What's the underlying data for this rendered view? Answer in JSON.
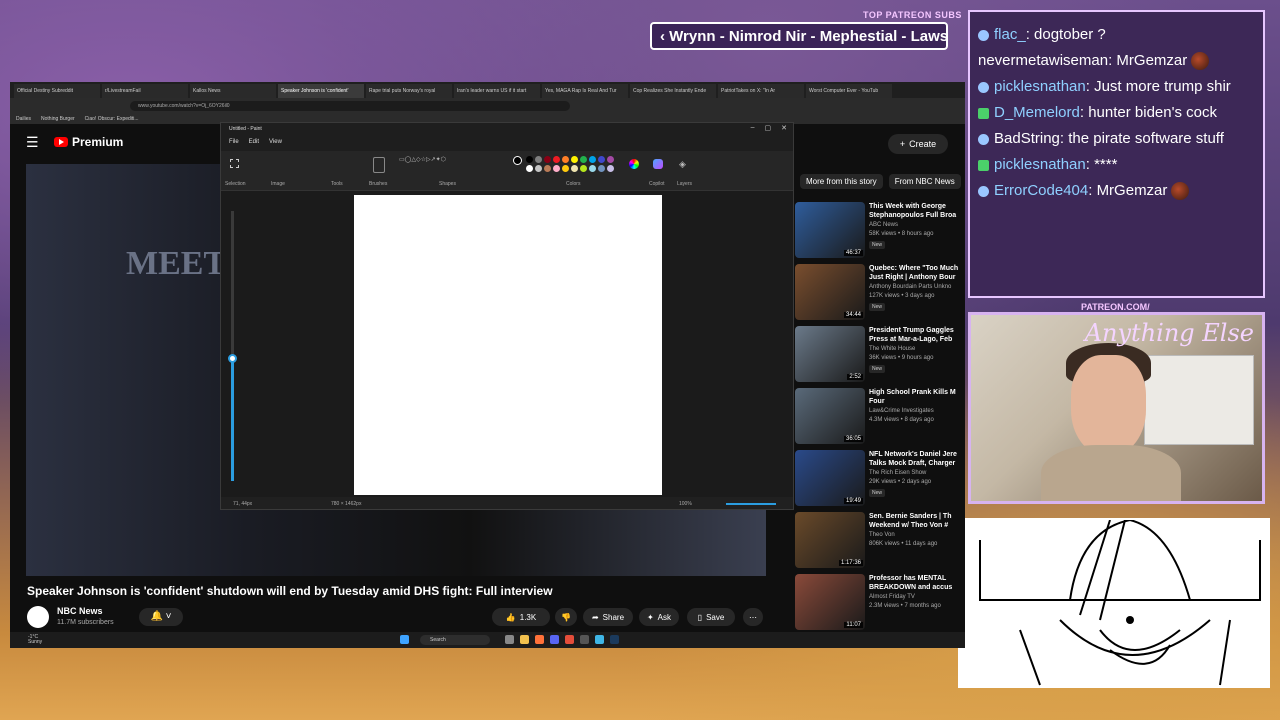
{
  "overlay": {
    "top_subs_label": "TOP PATREON SUBS",
    "ticker_text": "‹ Wrynn - Nimrod Nir - Mephestial - Lawsc",
    "patreon_label": "PATREON.COM/",
    "cam_logo": "Anything Else"
  },
  "chat": [
    {
      "badge": "b",
      "user": "flac_",
      "color": "blue",
      "message": "dogtober ?"
    },
    {
      "badge": "",
      "user": "nevermetawiseman",
      "color": "white",
      "message": "MrGemzar",
      "emote": true
    },
    {
      "badge": "b",
      "user": "picklesnathan",
      "color": "blue",
      "message": "Just more trump shir"
    },
    {
      "badge": "k",
      "user": "D_Memelord",
      "color": "blue",
      "message": "hunter biden's cock"
    },
    {
      "badge": "b",
      "user": "BadString",
      "color": "white",
      "message": "the pirate software stuff"
    },
    {
      "badge": "k",
      "user": "picklesnathan",
      "color": "blue",
      "message": "****"
    },
    {
      "badge": "b",
      "user": "ErrorCode404",
      "color": "blue",
      "message": "MrGemzar",
      "emote": true
    }
  ],
  "browser": {
    "tabs": [
      "Official Destiny Subreddit",
      "r/LivestreamFail",
      "Kallos News",
      "Speaker Johnson is 'confident'",
      "Rape trial puts Norway's royal",
      "Iran's leader warns US if it start",
      "Yes, MAGA Rap Is Real And Tur",
      "Cop Realizes She Instantly Ende",
      "PatriotTakes on X: \"In Ar",
      "Worst Computer Ever - YouTub"
    ],
    "active_tab_index": 3,
    "address": "www.youtube.com/watch?v=Oj_6OY26il0",
    "bookmarks": [
      "Dailies",
      "Nothing Burger",
      "Ciao! Obscur: Expediti..."
    ]
  },
  "youtube": {
    "logo_text": "Premium",
    "create_label": "Create",
    "video_title": "Speaker Johnson is 'confident' shutdown will end by Tuesday amid DHS fight: Full interview",
    "channel_name": "NBC News",
    "channel_subs": "11.7M subscribers",
    "likes": "1.3K",
    "share_label": "Share",
    "ask_label": "Ask",
    "save_label": "Save",
    "player_bg_text": "MEET THE PRESS",
    "rec_tabs": [
      "More from this story",
      "From NBC News"
    ],
    "recommendations": [
      {
        "title": "This Week with George Stephanopoulos Full Broa",
        "channel": "ABC News",
        "meta": "58K views • 8 hours ago",
        "duration": "46:37",
        "new": "New",
        "thumb": "#2f5d9c"
      },
      {
        "title": "Quebec: Where \"Too Much Just Right | Anthony Bour",
        "channel": "Anthony Bourdain Parts Unkno",
        "meta": "127K views • 3 days ago",
        "duration": "34:44",
        "new": "New",
        "thumb": "#7a4e2e"
      },
      {
        "title": "President Trump Gaggles Press at Mar-a-Lago, Feb",
        "channel": "The White House",
        "meta": "36K views • 9 hours ago",
        "duration": "2:52",
        "new": "New",
        "thumb": "#6b7a8a"
      },
      {
        "title": "High School Prank Kills M Four",
        "channel": "Law&Crime Investigates",
        "meta": "4.3M views • 8 days ago",
        "duration": "36:05",
        "new": "",
        "thumb": "#5a6a7a"
      },
      {
        "title": "NFL Network's Daniel Jere Talks Mock Draft, Charger",
        "channel": "The Rich Eisen Show",
        "meta": "29K views • 2 days ago",
        "duration": "19:49",
        "new": "New",
        "thumb": "#2a4a8a"
      },
      {
        "title": "Sen. Bernie Sanders | Th Weekend w/ Theo Von #",
        "channel": "Theo Von",
        "meta": "806K views • 11 days ago",
        "duration": "1:17:36",
        "new": "",
        "thumb": "#6a4a2a"
      },
      {
        "title": "Professor has MENTAL BREAKDOWN and accus",
        "channel": "Almost Friday TV",
        "meta": "2.3M views • 7 months ago",
        "duration": "11:07",
        "new": "",
        "thumb": "#8a4a3a"
      }
    ]
  },
  "paint": {
    "title": "Untitled - Paint",
    "menu": [
      "File",
      "Edit",
      "View"
    ],
    "groups": [
      "Selection",
      "Image",
      "Tools",
      "Brushes",
      "Shapes",
      "Colors",
      "Copilot",
      "Layers"
    ],
    "palette": [
      "#000000",
      "#7f7f7f",
      "#880015",
      "#ed1c24",
      "#ff7f27",
      "#fff200",
      "#22b14c",
      "#00a2e8",
      "#3f48cc",
      "#a349a4",
      "#ffffff",
      "#c3c3c3",
      "#b97a57",
      "#ffaec9",
      "#ffc90e",
      "#efe4b0",
      "#b5e61d",
      "#99d9ea",
      "#7092be",
      "#c8bfe7"
    ],
    "status_pos": "71, 44px",
    "status_size": "780 × 1462px",
    "zoom": "100%"
  },
  "taskbar": {
    "weather_temp": "-1°C",
    "weather_desc": "Sunny",
    "search_label": "Search"
  }
}
